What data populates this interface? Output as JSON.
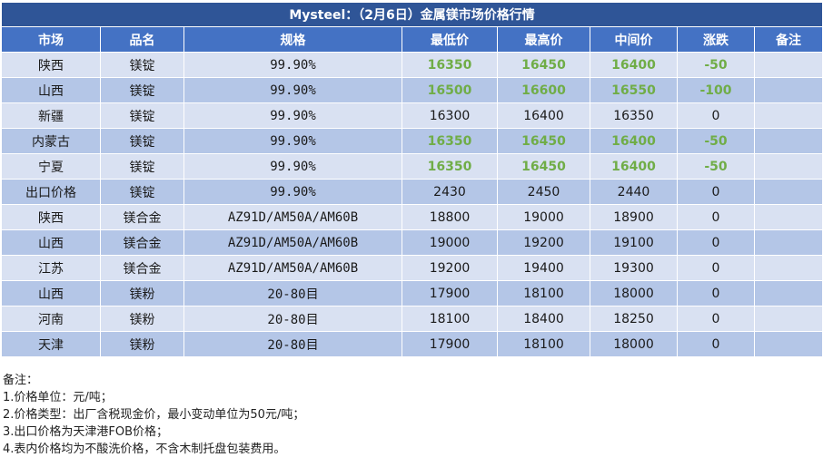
{
  "title": "Mysteel：（2月6日）金属镁市场价格行情",
  "headers": [
    "市场",
    "品名",
    "规格",
    "最低价",
    "最高价",
    "中间价",
    "涨跌",
    "备注"
  ],
  "rows": [
    {
      "market": "陕西",
      "product": "镁锭",
      "spec": "99.90%",
      "low": "16350",
      "high": "16450",
      "mid": "16400",
      "change": "-50",
      "remark": "",
      "highlight": true
    },
    {
      "market": "山西",
      "product": "镁锭",
      "spec": "99.90%",
      "low": "16500",
      "high": "16600",
      "mid": "16550",
      "change": "-100",
      "remark": "",
      "highlight": true
    },
    {
      "market": "新疆",
      "product": "镁锭",
      "spec": "99.90%",
      "low": "16300",
      "high": "16400",
      "mid": "16350",
      "change": "0",
      "remark": "",
      "highlight": false
    },
    {
      "market": "内蒙古",
      "product": "镁锭",
      "spec": "99.90%",
      "low": "16350",
      "high": "16450",
      "mid": "16400",
      "change": "-50",
      "remark": "",
      "highlight": true
    },
    {
      "market": "宁夏",
      "product": "镁锭",
      "spec": "99.90%",
      "low": "16350",
      "high": "16450",
      "mid": "16400",
      "change": "-50",
      "remark": "",
      "highlight": true
    },
    {
      "market": "出口价格",
      "product": "镁锭",
      "spec": "99.90%",
      "low": "2430",
      "high": "2450",
      "mid": "2440",
      "change": "0",
      "remark": "",
      "highlight": false
    },
    {
      "market": "陕西",
      "product": "镁合金",
      "spec": "AZ91D/AM50A/AM60B",
      "low": "18800",
      "high": "19000",
      "mid": "18900",
      "change": "0",
      "remark": "",
      "highlight": false
    },
    {
      "market": "山西",
      "product": "镁合金",
      "spec": "AZ91D/AM50A/AM60B",
      "low": "19000",
      "high": "19200",
      "mid": "19100",
      "change": "0",
      "remark": "",
      "highlight": false
    },
    {
      "market": "江苏",
      "product": "镁合金",
      "spec": "AZ91D/AM50A/AM60B",
      "low": "19200",
      "high": "19400",
      "mid": "19300",
      "change": "0",
      "remark": "",
      "highlight": false
    },
    {
      "market": "山西",
      "product": "镁粉",
      "spec": "20-80目",
      "low": "17900",
      "high": "18100",
      "mid": "18000",
      "change": "0",
      "remark": "",
      "highlight": false
    },
    {
      "market": "河南",
      "product": "镁粉",
      "spec": "20-80目",
      "low": "18100",
      "high": "18400",
      "mid": "18250",
      "change": "0",
      "remark": "",
      "highlight": false
    },
    {
      "market": "天津",
      "product": "镁粉",
      "spec": "20-80目",
      "low": "17900",
      "high": "18100",
      "mid": "18000",
      "change": "0",
      "remark": "",
      "highlight": false
    }
  ],
  "notes": [
    "备注：",
    "1.价格单位：元/吨；",
    "2.价格类型：出厂含税现金价，最小变动单位为50元/吨；",
    "3.出口价格为天津港FOB价格；",
    "4.表内价格均为不酸洗价格，不含木制托盘包装费用。"
  ],
  "colors": {
    "title_bg": "#2f5597",
    "header_bg": "#4472c4",
    "row_light": "#d9e1f2",
    "row_dark": "#b4c6e7",
    "change_highlight": "#70ad47"
  }
}
